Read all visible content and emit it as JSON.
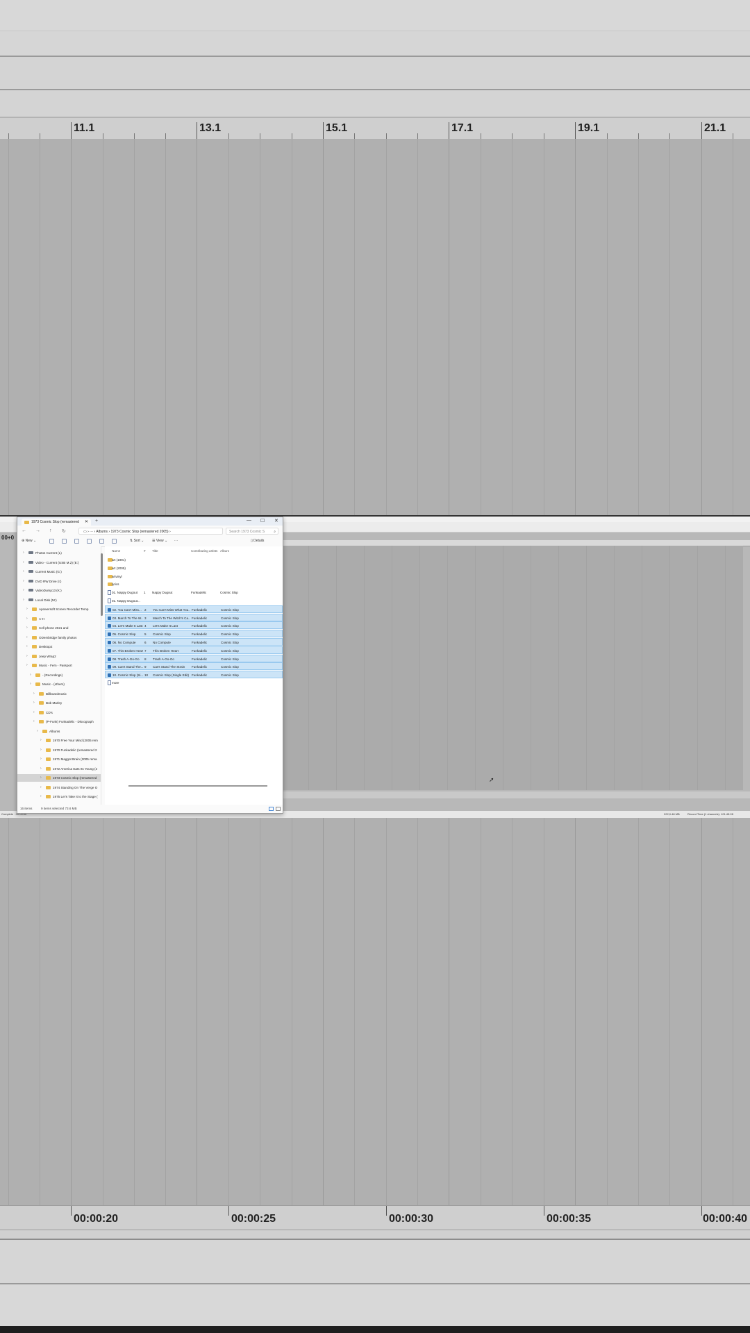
{
  "top_ruler": {
    "labels": [
      "11.1",
      "13.1",
      "15.1",
      "17.1",
      "19.1",
      "21.1"
    ]
  },
  "bottom_ruler": {
    "labels": [
      "00:00:20",
      "00:00:25",
      "00:00:30",
      "00:00:35",
      "00:00:40"
    ]
  },
  "mini_app": {
    "left_time": "00+0",
    "status_left": "Complete · 00:00:00",
    "status_right_1": "222,0.48 MB",
    "status_right_2": "Record Time (1 channels): 121:45:28"
  },
  "explorer": {
    "tab_title": "1973 Cosmic Slop (remastered",
    "new_tab": "+",
    "window_controls": [
      "—",
      "☐",
      "✕"
    ],
    "breadcrumb": [
      "Albums",
      "1973 Cosmic Slop (remastered 2005)"
    ],
    "search_placeholder": "Search 1973 Cosmic S",
    "cmd": {
      "new": "New",
      "sort": "Sort",
      "view": "View",
      "more": "···",
      "details": "Details"
    },
    "nav_items": [
      {
        "label": "Photos Current (L)",
        "type": "drive",
        "indent": 0
      },
      {
        "label": "Video - Current (USB M.2) (E:)",
        "type": "drive",
        "indent": 0
      },
      {
        "label": "Current Music (G:)",
        "type": "drive",
        "indent": 0
      },
      {
        "label": "DVD RW Drive (I:)",
        "type": "drive",
        "indent": 0
      },
      {
        "label": "VideoDump13 (K:)",
        "type": "drive",
        "indent": 0
      },
      {
        "label": "Local Disk (M:)",
        "type": "drive",
        "indent": 0
      },
      {
        "label": "Apowersoft Screen Recorder Temp",
        "type": "folder",
        "indent": 1
      },
      {
        "label": "A-H",
        "type": "folder",
        "indent": 1
      },
      {
        "label": "Cell phone 2021 and",
        "type": "folder",
        "indent": 1
      },
      {
        "label": "ODembridge family photos",
        "type": "folder",
        "indent": 1
      },
      {
        "label": "Desktop2",
        "type": "folder",
        "indent": 1
      },
      {
        "label": "Jeep Wrap2",
        "type": "folder",
        "indent": 1
      },
      {
        "label": "Music - Fern - Passport",
        "type": "folder",
        "indent": 1
      },
      {
        "label": "- (Recordings)",
        "type": "folder",
        "indent": 2
      },
      {
        "label": "Music - (others)",
        "type": "folder",
        "indent": 2
      },
      {
        "label": "Billboardmusic",
        "type": "folder",
        "indent": 3
      },
      {
        "label": "Bob Marley",
        "type": "folder",
        "indent": 3
      },
      {
        "label": "CD's",
        "type": "folder",
        "indent": 3
      },
      {
        "label": "(P-Funk) Funkadelic - Discograph",
        "type": "folder",
        "indent": 3
      },
      {
        "label": "Albums",
        "type": "folder",
        "indent": 4
      },
      {
        "label": "1970 Free Your Mind (2005 rem",
        "type": "folder",
        "indent": 5
      },
      {
        "label": "1970 Funkadelic (remastered 2",
        "type": "folder",
        "indent": 5
      },
      {
        "label": "1971 Maggot Brain (2005 rema",
        "type": "folder",
        "indent": 5
      },
      {
        "label": "1972 America Eats Its Young (2",
        "type": "folder",
        "indent": 5
      },
      {
        "label": "1973 Cosmic Slop (remastered",
        "type": "folder",
        "indent": 5,
        "selected": true
      },
      {
        "label": "1974 Standing On The Verge O",
        "type": "folder",
        "indent": 5
      },
      {
        "label": "1975 Let's Take It to the Stage (",
        "type": "folder",
        "indent": 5
      }
    ],
    "columns": [
      "Name",
      "#",
      "Title",
      "Contributing artists",
      "Album"
    ],
    "rows": [
      {
        "name": "art (1991)",
        "num": "",
        "title": "",
        "artist": "",
        "album": "",
        "kind": "folder"
      },
      {
        "name": "art (2005)",
        "num": "",
        "title": "",
        "artist": "",
        "album": "",
        "kind": "folder"
      },
      {
        "name": "artvinyl",
        "num": "",
        "title": "",
        "artist": "",
        "album": "",
        "kind": "folder"
      },
      {
        "name": "lyrics",
        "num": "",
        "title": "",
        "artist": "",
        "album": "",
        "kind": "folder"
      },
      {
        "name": "01. Nappy Dugout",
        "num": "1",
        "title": "Nappy Dugout",
        "artist": "Funkadelic",
        "album": "Cosmic Slop",
        "kind": "media"
      },
      {
        "name": "01. Nappy Dugout...",
        "num": "",
        "title": "",
        "artist": "",
        "album": "",
        "kind": "file"
      },
      {
        "name": "02. You Can't Miss...",
        "num": "2",
        "title": "You Can't Miss What You...",
        "artist": "Funkadelic",
        "album": "Cosmic Slop",
        "kind": "media",
        "selected": true
      },
      {
        "name": "03. March To The W...",
        "num": "3",
        "title": "March To The Witch's Ca...",
        "artist": "Funkadelic",
        "album": "Cosmic Slop",
        "kind": "media",
        "selected": true
      },
      {
        "name": "04. Let's Make It Last",
        "num": "4",
        "title": "Let's Make It Last",
        "artist": "Funkadelic",
        "album": "Cosmic Slop",
        "kind": "media",
        "selected": true
      },
      {
        "name": "05. Cosmic Slop",
        "num": "5",
        "title": "Cosmic Slop",
        "artist": "Funkadelic",
        "album": "Cosmic Slop",
        "kind": "media",
        "selected": true
      },
      {
        "name": "06. No Compute",
        "num": "6",
        "title": "No Compute",
        "artist": "Funkadelic",
        "album": "Cosmic Slop",
        "kind": "media",
        "selected": true
      },
      {
        "name": "07. This Broken Heart",
        "num": "7",
        "title": "This Broken Heart",
        "artist": "Funkadelic",
        "album": "Cosmic Slop",
        "kind": "media",
        "selected": true
      },
      {
        "name": "08. Trash A-Go-Go",
        "num": "8",
        "title": "Trash A-Go-Go",
        "artist": "Funkadelic",
        "album": "Cosmic Slop",
        "kind": "media",
        "selected": true
      },
      {
        "name": "09. Can't Stand The...",
        "num": "9",
        "title": "Can't Stand The Strain",
        "artist": "Funkadelic",
        "album": "Cosmic Slop",
        "kind": "media",
        "selected": true
      },
      {
        "name": "10. Cosmic Slop (Si...",
        "num": "10",
        "title": "Cosmic Slop (Single Edit)",
        "artist": "Funkadelic",
        "album": "Cosmic Slop",
        "kind": "media",
        "selected": true
      },
      {
        "name": "more",
        "num": "",
        "title": "",
        "artist": "",
        "album": "",
        "kind": "file"
      }
    ],
    "status_items": "16 items",
    "status_selected": "9 items selected  73.6 MB"
  }
}
